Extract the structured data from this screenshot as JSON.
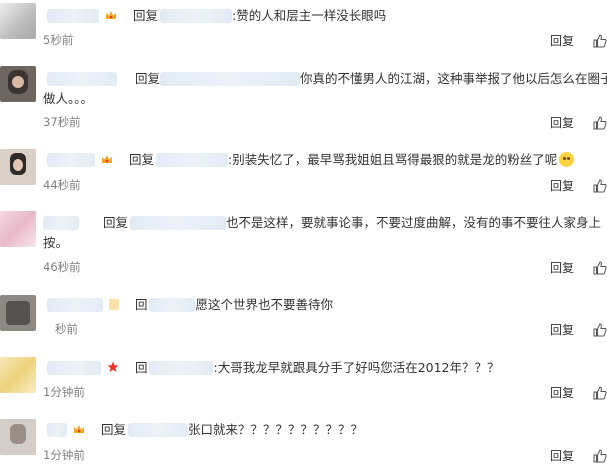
{
  "comments": [
    {
      "prefix": "回复",
      "text": ":赞的人和层主一样没长眼吗",
      "time": "5秒前",
      "reply_label": "回复"
    },
    {
      "prefix": "回复",
      "text": "你真的不懂男人的江湖，这种事举报了他以后怎么在圈子里",
      "text2": "做人。。。",
      "time": "37秒前",
      "reply_label": "回复"
    },
    {
      "prefix": "回复",
      "text": ":别装失忆了，最早骂我姐姐且骂得最狠的就是龙的粉丝了呢",
      "time": "44秒前",
      "reply_label": "回复",
      "emoji": "fearful-face-emoji"
    },
    {
      "prefix": "回复",
      "text": "也不是这样，要就事论事，不要过度曲解，没有的事不要往人家身上",
      "text2": "按。",
      "time": "46秒前",
      "reply_label": "回复"
    },
    {
      "prefix": "回",
      "text": "愿这个世界也不要善待你",
      "time": "秒前",
      "reply_label": "回复"
    },
    {
      "prefix": "回",
      "text": ":大哥我龙早就跟具分手了好吗您活在2012年？？？",
      "time": "1分钟前",
      "reply_label": "回复"
    },
    {
      "prefix": "回复",
      "text": "张口就来？？？？？？？？？？",
      "time": "1分钟前",
      "reply_label": "回复"
    }
  ],
  "colors": {
    "crown": "#f5a623",
    "star": "#e8362b",
    "time": "#808080"
  }
}
